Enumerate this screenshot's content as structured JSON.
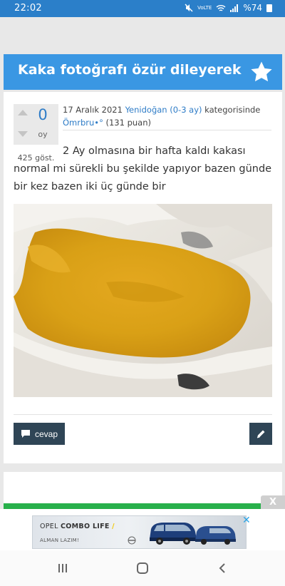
{
  "status_bar": {
    "time": "22:02",
    "network": "VoLTE",
    "battery": "%74"
  },
  "post": {
    "title": "Kaka fotoğrafı özür dileyerek",
    "vote_count": "0",
    "vote_unit": "oy",
    "views": "425 göst.",
    "date": "17 Aralık 2021",
    "category": "Yenidoğan (0-3 ay)",
    "category_suffix": "kategorisinde",
    "author": "Ömrbru•°",
    "points": "(131 puan)",
    "question": "2 Ay olmasına bir hafta kaldı kakası normal mi sürekli bu şekilde yapıyor bazen günde bir kez bazen iki üç günde bir",
    "reply_label": "cevap"
  },
  "ad": {
    "close_label": "X",
    "brand": "OPEL",
    "model": "COMBO LIFE",
    "tagline": "ALMAN LAZIM!",
    "accent": "#f2c800"
  },
  "colors": {
    "status_bar": "#2b7fc9",
    "title_bar": "#3a97e3",
    "link": "#2e7cc7",
    "button": "#2f4556",
    "green_line": "#28b04b"
  }
}
